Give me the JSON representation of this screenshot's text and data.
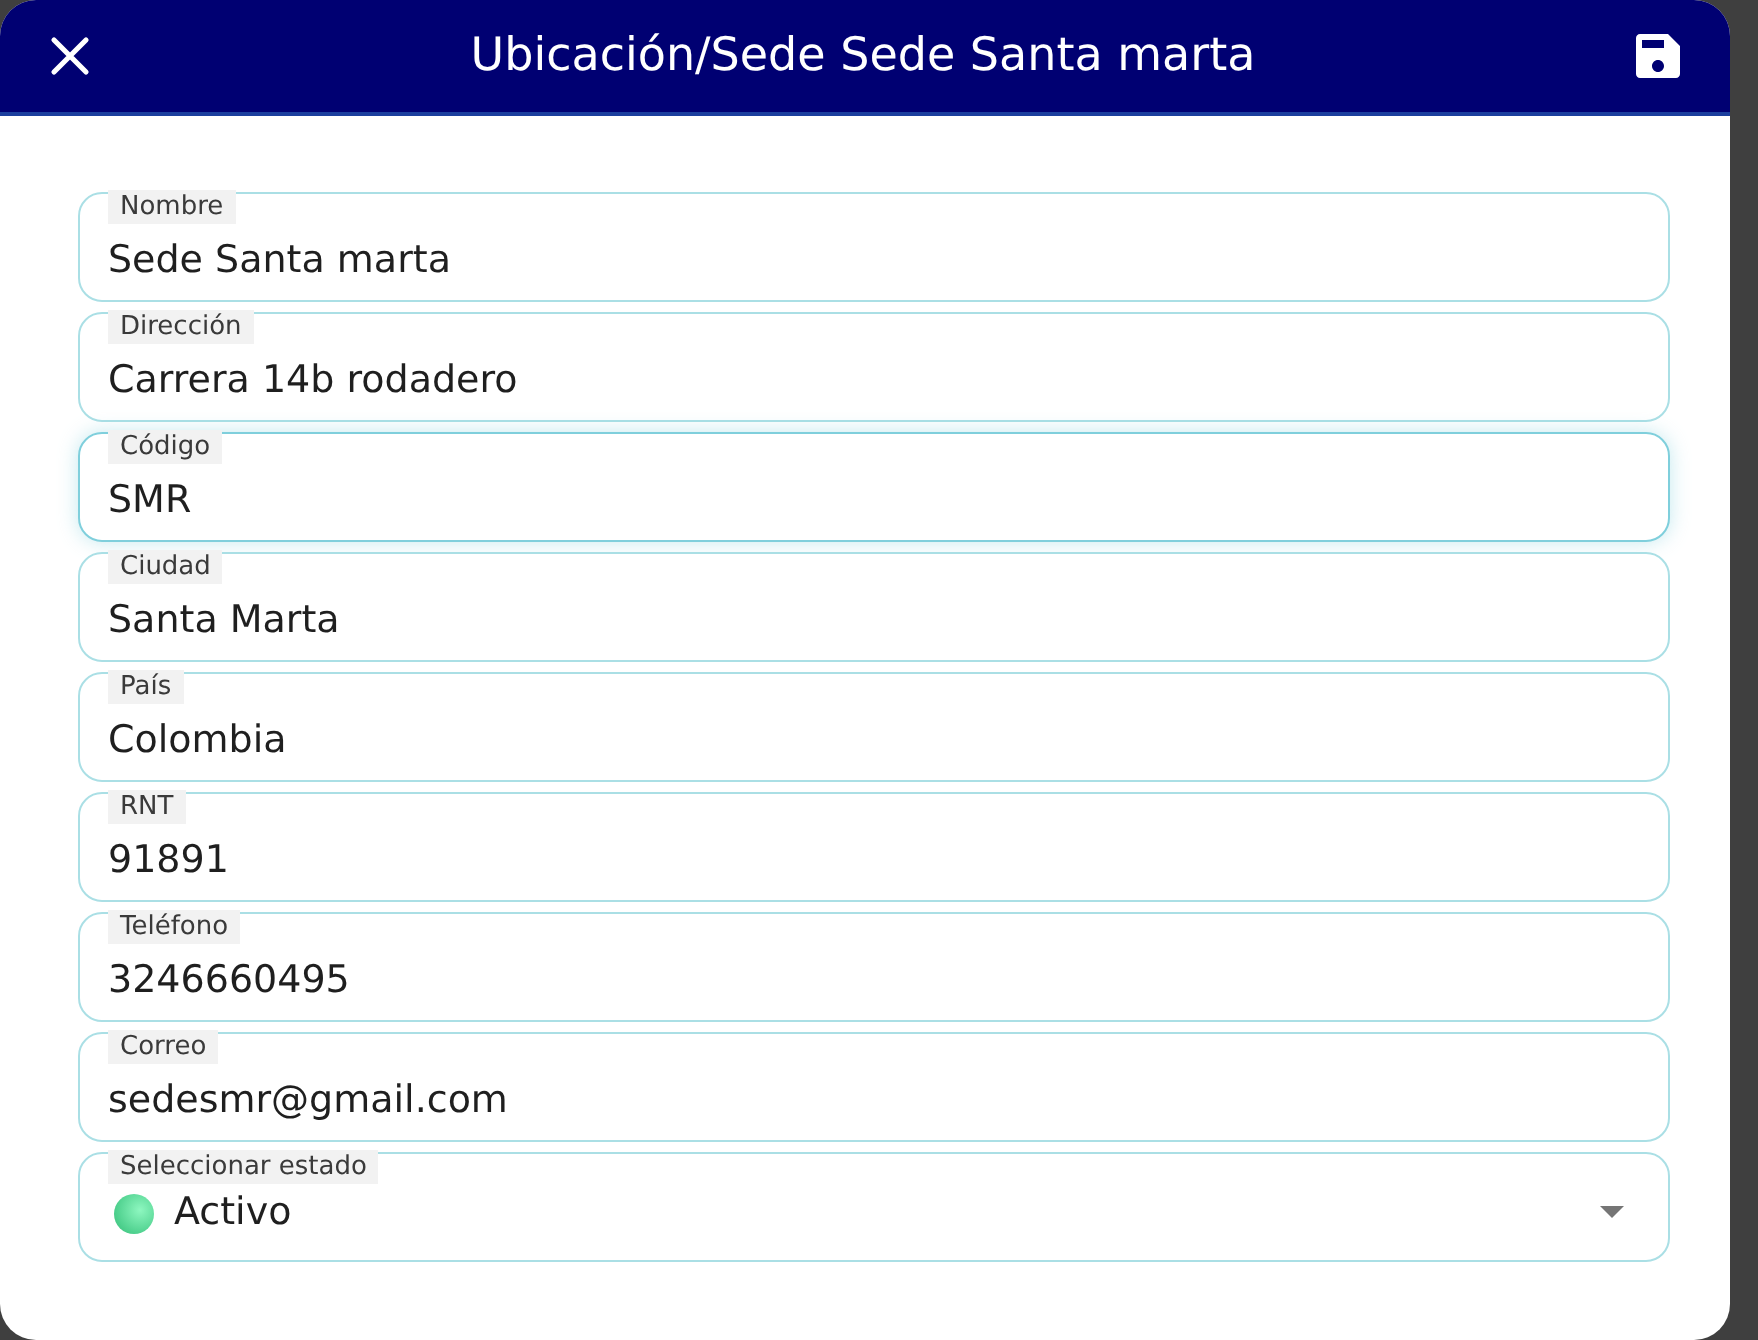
{
  "window": {
    "title": "Ubicación/Sede Sede Santa marta"
  },
  "fields": [
    {
      "kind": "text",
      "label": "Nombre",
      "value": "Sede Santa marta",
      "focused": false
    },
    {
      "kind": "text",
      "label": "Dirección",
      "value": "Carrera 14b rodadero",
      "focused": false
    },
    {
      "kind": "text",
      "label": "Código",
      "value": "SMR",
      "focused": true
    },
    {
      "kind": "text",
      "label": "Ciudad",
      "value": "Santa Marta",
      "focused": false
    },
    {
      "kind": "text",
      "label": "País",
      "value": "Colombia",
      "focused": false
    },
    {
      "kind": "text",
      "label": "RNT",
      "value": "91891",
      "focused": false
    },
    {
      "kind": "text",
      "label": "Teléfono",
      "value": "3246660495",
      "focused": false
    },
    {
      "kind": "text",
      "label": "Correo",
      "value": "sedesmr@gmail.com",
      "focused": false
    },
    {
      "kind": "select",
      "label": "Seleccionar estado",
      "value": "Activo",
      "focused": false
    }
  ]
}
